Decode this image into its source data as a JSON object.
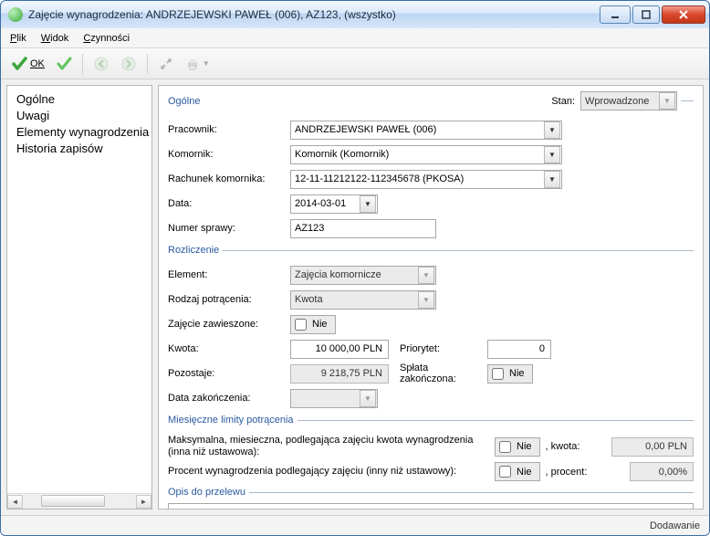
{
  "window": {
    "title": "Zajęcie wynagrodzenia: ANDRZEJEWSKI PAWEŁ (006), AZ123, (wszystko)"
  },
  "menu": {
    "plik": "Plik",
    "widok": "Widok",
    "czynnosci": "Czynności"
  },
  "toolbar": {
    "ok_label": "OK"
  },
  "sidebar": {
    "items": [
      {
        "label": "Ogólne"
      },
      {
        "label": "Uwagi"
      },
      {
        "label": "Elementy wynagrodzenia"
      },
      {
        "label": "Historia zapisów"
      }
    ]
  },
  "section": {
    "ogolne": "Ogólne",
    "rozliczenie": "Rozliczenie",
    "miesieczne": "Miesięczne limity potrącenia",
    "opis": "Opis do przelewu"
  },
  "stan": {
    "label": "Stan:",
    "value": "Wprowadzone"
  },
  "ogolne": {
    "pracownik_label": "Pracownik:",
    "pracownik_value": "ANDRZEJEWSKI PAWEŁ (006)",
    "komornik_label": "Komornik:",
    "komornik_value": "Komornik (Komornik)",
    "rachunek_label": "Rachunek komornika:",
    "rachunek_value": "12-11-11212122-112345678 (PKOSA)",
    "data_label": "Data:",
    "data_value": "2014-03-01",
    "numer_label": "Numer sprawy:",
    "numer_value": "AZ123"
  },
  "rozliczenie": {
    "element_label": "Element:",
    "element_value": "Zajęcia komornicze",
    "rodzaj_label": "Rodzaj potrącenia:",
    "rodzaj_value": "Kwota",
    "zawieszone_label": "Zajęcie zawieszone:",
    "zawieszone_value": "Nie",
    "kwota_label": "Kwota:",
    "kwota_value": "10 000,00 PLN",
    "priorytet_label": "Priorytet:",
    "priorytet_value": "0",
    "pozostaje_label": "Pozostaje:",
    "pozostaje_value": "9 218,75 PLN",
    "splata_label": "Spłata zakończona:",
    "splata_value": "Nie",
    "datazak_label": "Data zakończenia:",
    "datazak_value": ""
  },
  "limits": {
    "maks_label": "Maksymalna, miesieczna, podlegająca zajęciu kwota wynagrodzenia (inna niż ustawowa):",
    "maks_chk": "Nie",
    "maks_post": ", kwota:",
    "maks_value": "0,00 PLN",
    "proc_label": "Procent wynagrodzenia podlegający zajęciu (inny niż ustawowy):",
    "proc_chk": "Nie",
    "proc_post": ", procent:",
    "proc_value": "0,00%"
  },
  "statusbar": {
    "state": "Dodawanie"
  }
}
